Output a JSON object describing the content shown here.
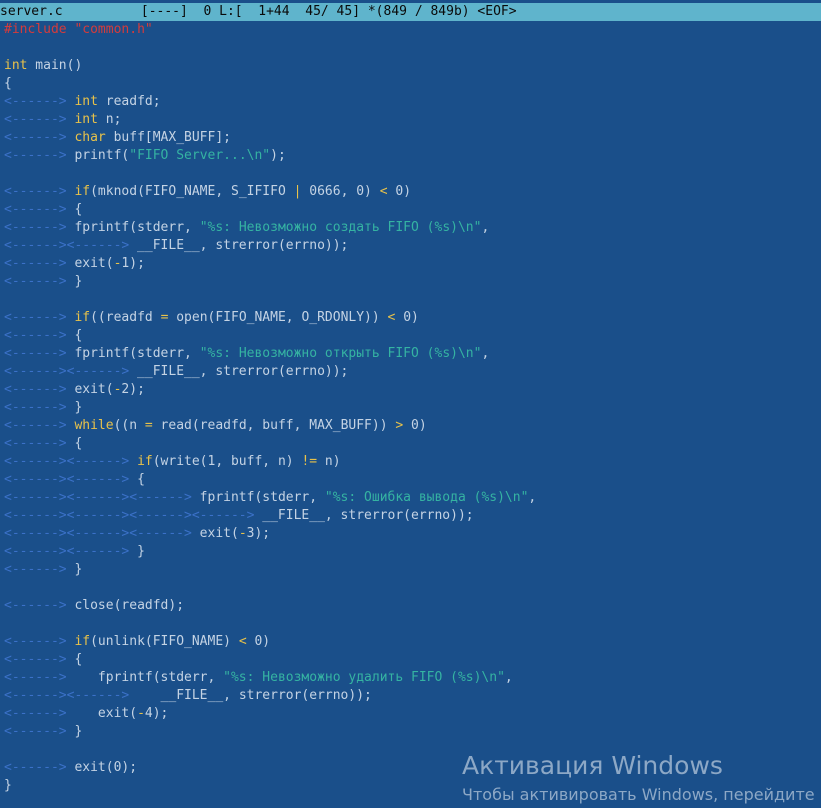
{
  "status_bar": {
    "text": "server.c          [----]  0 L:[  1+44  45/ 45] *(849 / 849b) <EOF>"
  },
  "colors": {
    "background": "#1a4f8a",
    "status_bar": "#5fb4cc",
    "keyword": "#e8c24a",
    "string": "#35b3a2",
    "preprocessor": "#d53b3b",
    "tab_marker": "#3b71c8",
    "text": "#c4d3e4"
  },
  "code_lines": [
    [
      [
        "#include ",
        "pre"
      ],
      [
        "\"common.h\"",
        "incstr"
      ]
    ],
    [],
    [
      [
        "int",
        "kw"
      ],
      [
        " main",
        "id"
      ],
      [
        "()",
        "bracket"
      ]
    ],
    [
      [
        "{",
        "bracket"
      ]
    ],
    [
      [
        "<------> ",
        "tab"
      ],
      [
        "int",
        "kw"
      ],
      [
        " readfd;",
        "id"
      ]
    ],
    [
      [
        "<------> ",
        "tab"
      ],
      [
        "int",
        "kw"
      ],
      [
        " n;",
        "id"
      ]
    ],
    [
      [
        "<------> ",
        "tab"
      ],
      [
        "char",
        "kw"
      ],
      [
        " buff[MAX_BUFF];",
        "id"
      ]
    ],
    [
      [
        "<------> ",
        "tab"
      ],
      [
        "printf(",
        "id"
      ],
      [
        "\"FIFO Server...\\n\"",
        "str"
      ],
      [
        ");",
        "id"
      ]
    ],
    [],
    [
      [
        "<------> ",
        "tab"
      ],
      [
        "if",
        "kw"
      ],
      [
        "(mknod(FIFO_NAME, S_IFIFO ",
        "id"
      ],
      [
        "|",
        "op"
      ],
      [
        " 0666, 0) ",
        "id"
      ],
      [
        "<",
        "op"
      ],
      [
        " 0)",
        "id"
      ]
    ],
    [
      [
        "<------> ",
        "tab"
      ],
      [
        "{",
        "bracket"
      ]
    ],
    [
      [
        "<------> ",
        "tab"
      ],
      [
        "fprintf(stderr, ",
        "id"
      ],
      [
        "\"%s: Невозможно создать FIFO (%s)\\n\"",
        "str"
      ],
      [
        ",",
        "id"
      ]
    ],
    [
      [
        "<------><------>",
        "tab"
      ],
      [
        " __FILE__, strerror(errno));",
        "id"
      ]
    ],
    [
      [
        "<------> ",
        "tab"
      ],
      [
        "exit(",
        "id"
      ],
      [
        "-",
        "op"
      ],
      [
        "1);",
        "id"
      ]
    ],
    [
      [
        "<------> ",
        "tab"
      ],
      [
        "}",
        "bracket"
      ]
    ],
    [],
    [
      [
        "<------> ",
        "tab"
      ],
      [
        "if",
        "kw"
      ],
      [
        "((readfd ",
        "id"
      ],
      [
        "=",
        "op"
      ],
      [
        " open(FIFO_NAME, O_RDONLY)) ",
        "id"
      ],
      [
        "<",
        "op"
      ],
      [
        " 0)",
        "id"
      ]
    ],
    [
      [
        "<------> ",
        "tab"
      ],
      [
        "{",
        "bracket"
      ]
    ],
    [
      [
        "<------> ",
        "tab"
      ],
      [
        "fprintf(stderr, ",
        "id"
      ],
      [
        "\"%s: Невозможно открыть FIFO (%s)\\n\"",
        "str"
      ],
      [
        ",",
        "id"
      ]
    ],
    [
      [
        "<------><------>",
        "tab"
      ],
      [
        " __FILE__, strerror(errno));",
        "id"
      ]
    ],
    [
      [
        "<------> ",
        "tab"
      ],
      [
        "exit(",
        "id"
      ],
      [
        "-",
        "op"
      ],
      [
        "2);",
        "id"
      ]
    ],
    [
      [
        "<------> ",
        "tab"
      ],
      [
        "}",
        "bracket"
      ]
    ],
    [
      [
        "<------> ",
        "tab"
      ],
      [
        "while",
        "kw"
      ],
      [
        "((n ",
        "id"
      ],
      [
        "=",
        "op"
      ],
      [
        " read(readfd, buff, MAX_BUFF)) ",
        "id"
      ],
      [
        ">",
        "op"
      ],
      [
        " 0)",
        "id"
      ]
    ],
    [
      [
        "<------> ",
        "tab"
      ],
      [
        "{",
        "bracket"
      ]
    ],
    [
      [
        "<------><------> ",
        "tab"
      ],
      [
        "if",
        "kw"
      ],
      [
        "(write(1, buff, n) ",
        "id"
      ],
      [
        "!=",
        "op"
      ],
      [
        " n)",
        "id"
      ]
    ],
    [
      [
        "<------><------> ",
        "tab"
      ],
      [
        "{",
        "bracket"
      ]
    ],
    [
      [
        "<------><------><------> ",
        "tab"
      ],
      [
        "fprintf(stderr, ",
        "id"
      ],
      [
        "\"%s: Ошибка вывода (%s)\\n\"",
        "str"
      ],
      [
        ",",
        "id"
      ]
    ],
    [
      [
        "<------><------><------><------> ",
        "tab"
      ],
      [
        "__FILE__, strerror(errno));",
        "id"
      ]
    ],
    [
      [
        "<------><------><------> ",
        "tab"
      ],
      [
        "exit(",
        "id"
      ],
      [
        "-",
        "op"
      ],
      [
        "3);",
        "id"
      ]
    ],
    [
      [
        "<------><------> ",
        "tab"
      ],
      [
        "}",
        "bracket"
      ]
    ],
    [
      [
        "<------> ",
        "tab"
      ],
      [
        "}",
        "bracket"
      ]
    ],
    [],
    [
      [
        "<------> ",
        "tab"
      ],
      [
        "close(readfd);",
        "id"
      ]
    ],
    [],
    [
      [
        "<------> ",
        "tab"
      ],
      [
        "if",
        "kw"
      ],
      [
        "(unlink(FIFO_NAME) ",
        "id"
      ],
      [
        "<",
        "op"
      ],
      [
        " 0)",
        "id"
      ]
    ],
    [
      [
        "<------> ",
        "tab"
      ],
      [
        "{",
        "bracket"
      ]
    ],
    [
      [
        "<------>    ",
        "tab"
      ],
      [
        "fprintf(stderr, ",
        "id"
      ],
      [
        "\"%s: Невозможно удалить FIFO (%s)\\n\"",
        "str"
      ],
      [
        ",",
        "id"
      ]
    ],
    [
      [
        "<------><------>    ",
        "tab"
      ],
      [
        "__FILE__, strerror(errno));",
        "id"
      ]
    ],
    [
      [
        "<------>    ",
        "tab"
      ],
      [
        "exit(",
        "id"
      ],
      [
        "-",
        "op"
      ],
      [
        "4);",
        "id"
      ]
    ],
    [
      [
        "<------> ",
        "tab"
      ],
      [
        "}",
        "bracket"
      ]
    ],
    [],
    [
      [
        "<------> ",
        "tab"
      ],
      [
        "exit(0);",
        "id"
      ]
    ],
    [
      [
        "}",
        "bracket"
      ]
    ]
  ],
  "watermark": {
    "title": "Активация Windows",
    "subtitle": "Чтобы активировать Windows, перейдите в"
  }
}
